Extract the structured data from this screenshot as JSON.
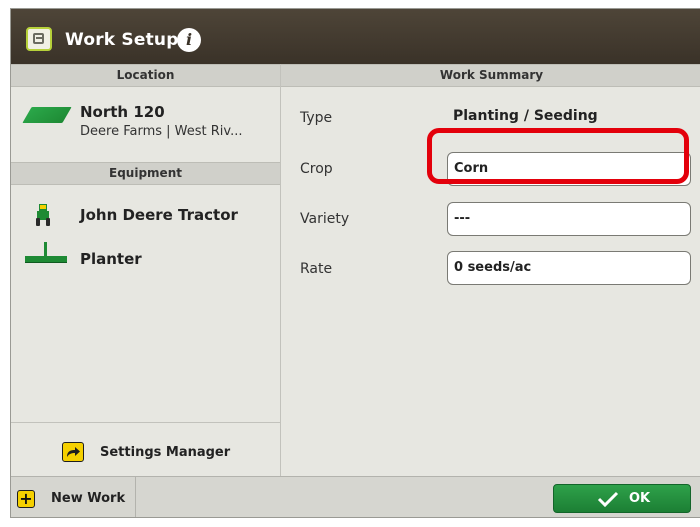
{
  "window": {
    "title": "Work Setup"
  },
  "location": {
    "header": "Location",
    "name": "North 120",
    "subtitle": "Deere Farms | West Riv..."
  },
  "equipment": {
    "header": "Equipment",
    "items": [
      {
        "label": "John Deere Tractor",
        "icon": "tractor-icon"
      },
      {
        "label": "Planter",
        "icon": "planter-icon"
      }
    ]
  },
  "settings_manager": {
    "label": "Settings Manager"
  },
  "work_summary": {
    "header": "Work Summary",
    "type": {
      "label": "Type",
      "value": "Planting / Seeding"
    },
    "crop": {
      "label": "Crop",
      "value": "Corn"
    },
    "variety": {
      "label": "Variety",
      "value": "---"
    },
    "rate": {
      "label": "Rate",
      "value": "0 seeds/ac"
    }
  },
  "footer": {
    "new_work_label": "New Work",
    "ok_label": "OK"
  },
  "colors": {
    "title_bar": "#3a3228",
    "accent_green": "#1e8a34",
    "yellow_icon": "#f5d000",
    "highlight_red": "#e3000b",
    "panel_bg": "#e7e7e1"
  }
}
